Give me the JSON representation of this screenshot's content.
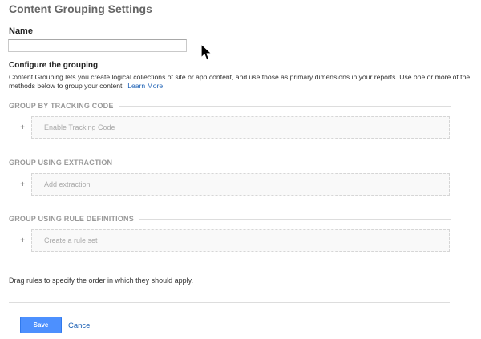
{
  "page": {
    "title": "Content Grouping Settings"
  },
  "name_field": {
    "label": "Name",
    "value": "",
    "placeholder": ""
  },
  "configure": {
    "title": "Configure the grouping",
    "description": "Content Grouping lets you create logical collections of site or app content, and use those as primary dimensions in your reports. Use one or more of the methods below to group your content.",
    "learn_more": "Learn More"
  },
  "sections": [
    {
      "title": "GROUP BY TRACKING CODE",
      "plus": "+",
      "action": "Enable Tracking Code"
    },
    {
      "title": "GROUP USING EXTRACTION",
      "plus": "+",
      "action": "Add extraction"
    },
    {
      "title": "GROUP USING RULE DEFINITIONS",
      "plus": "+",
      "action": "Create a rule set"
    }
  ],
  "drag_note": "Drag rules to specify the order in which they should apply.",
  "footer": {
    "save_label": "Save",
    "cancel_label": "Cancel"
  },
  "colors": {
    "primary_button": "#4d90fe",
    "link": "#1a5fb4",
    "muted_header": "#999999"
  },
  "icons": {
    "cursor": "mouse-pointer-icon",
    "plus": "plus-icon"
  }
}
